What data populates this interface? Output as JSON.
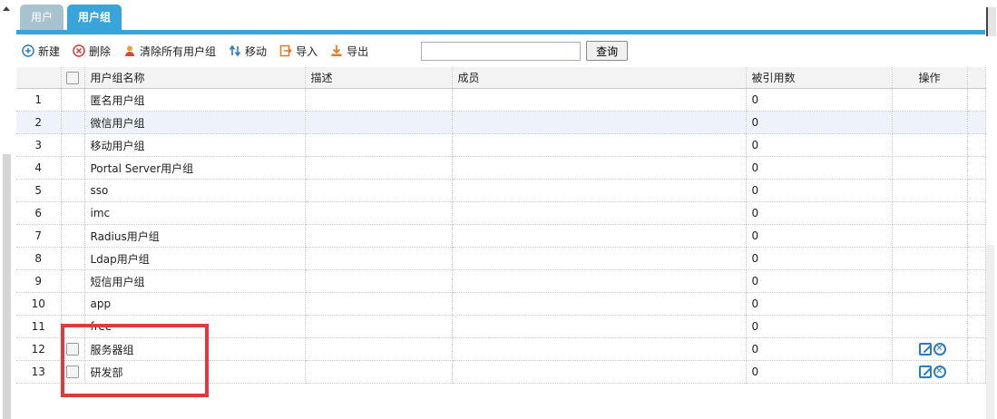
{
  "tabs": [
    {
      "label": "用户"
    },
    {
      "label": "用户组"
    }
  ],
  "toolbar": {
    "new_label": "新建",
    "delete_label": "删除",
    "clear_label": "清除所有用户组",
    "move_label": "移动",
    "import_label": "导入",
    "export_label": "导出",
    "search_value": "",
    "search_button": "查询"
  },
  "table": {
    "headers": {
      "name": "用户组名称",
      "desc": "描述",
      "members": "成员",
      "refs": "被引用数",
      "ops": "操作"
    },
    "rows": [
      {
        "num": "1",
        "name": "匿名用户组",
        "refs": "0"
      },
      {
        "num": "2",
        "name": "微信用户组",
        "refs": "0"
      },
      {
        "num": "3",
        "name": "移动用户组",
        "refs": "0"
      },
      {
        "num": "4",
        "name": "Portal Server用户组",
        "refs": "0"
      },
      {
        "num": "5",
        "name": "sso",
        "refs": "0"
      },
      {
        "num": "6",
        "name": "imc",
        "refs": "0"
      },
      {
        "num": "7",
        "name": "Radius用户组",
        "refs": "0"
      },
      {
        "num": "8",
        "name": "Ldap用户组",
        "refs": "0"
      },
      {
        "num": "9",
        "name": "短信用户组",
        "refs": "0"
      },
      {
        "num": "10",
        "name": "app",
        "refs": "0"
      },
      {
        "num": "11",
        "name": "free",
        "refs": "0"
      },
      {
        "num": "12",
        "name": "服务器组",
        "refs": "0"
      },
      {
        "num": "13",
        "name": "研发部",
        "refs": "0"
      }
    ]
  },
  "colors": {
    "tab_active": "#39a4d8",
    "tab_inactive": "#a9c2d0",
    "highlight_row": "#eef3fb",
    "annotation": "#e53838",
    "icon_blue": "#2a7cc0"
  }
}
